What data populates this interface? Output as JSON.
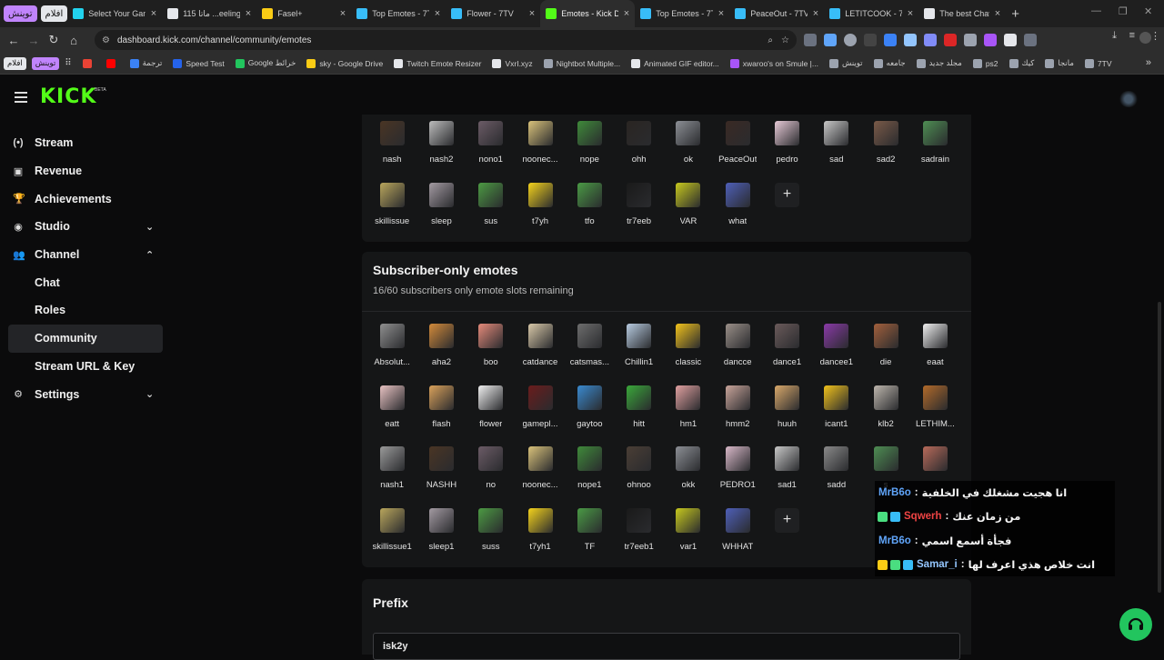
{
  "browser": {
    "tab_groups": [
      {
        "label": "توينش",
        "color": "#c084fc"
      },
      {
        "label": "افلام",
        "color": "#e5e7eb"
      }
    ],
    "tabs": [
      {
        "title": "Select Your Gam",
        "fav_color": "#22d3ee",
        "active": false
      },
      {
        "title": "ماتا 115 ...eeling",
        "fav_color": "#e5e7eb",
        "active": false
      },
      {
        "title": "Fasel+",
        "fav_color": "#facc15",
        "active": false
      },
      {
        "title": "Top Emotes - 7T",
        "fav_color": "#38bdf8",
        "active": false
      },
      {
        "title": "Flower - 7TV",
        "fav_color": "#38bdf8",
        "active": false
      },
      {
        "title": "Emotes - Kick D",
        "fav_color": "#53fc18",
        "active": true
      },
      {
        "title": "Top Emotes - 7T",
        "fav_color": "#38bdf8",
        "active": false
      },
      {
        "title": "PeaceOut - 7TV",
        "fav_color": "#38bdf8",
        "active": false
      },
      {
        "title": "LETITCOOK - 7T",
        "fav_color": "#38bdf8",
        "active": false
      },
      {
        "title": "The best ChatB",
        "fav_color": "#e5e7eb",
        "active": false
      }
    ],
    "new_tab": "+",
    "window_controls": [
      "—",
      "❐",
      "✕"
    ],
    "url": "dashboard.kick.com/channel/community/emotes",
    "bookmarks_chips": [
      {
        "label": "افلام",
        "color": "#e5e7eb"
      },
      {
        "label": "توينش",
        "color": "#c084fc"
      }
    ],
    "bookmarks": [
      {
        "label": "ترجمة",
        "color": "#3b82f6"
      },
      {
        "label": "Speed Test",
        "color": "#2563eb"
      },
      {
        "label": "Google خرائط",
        "color": "#22c55e"
      },
      {
        "label": "sky - Google Drive",
        "color": "#facc15"
      },
      {
        "label": "Twitch Emote Resizer",
        "color": "#e5e7eb"
      },
      {
        "label": "VxrI.xyz",
        "color": "#e5e7eb"
      },
      {
        "label": "Nightbot Multiple...",
        "color": "#9ca3af"
      },
      {
        "label": "Animated GIF editor...",
        "color": "#e5e7eb"
      },
      {
        "label": "xwaroo's on Smule |...",
        "color": "#a855f7"
      },
      {
        "label": "توينش",
        "color": "#9ca3af"
      },
      {
        "label": "جامعه",
        "color": "#9ca3af"
      },
      {
        "label": "مجلد جديد",
        "color": "#9ca3af"
      },
      {
        "label": "ps2",
        "color": "#9ca3af"
      },
      {
        "label": "كيك",
        "color": "#9ca3af"
      },
      {
        "label": "مانجا",
        "color": "#9ca3af"
      },
      {
        "label": "7TV",
        "color": "#9ca3af"
      }
    ]
  },
  "app": {
    "logo": "KICK",
    "beta": "BETA",
    "accent": "#53fc18",
    "sidebar": [
      {
        "label": "Stream",
        "icon": "(•)",
        "chev": ""
      },
      {
        "label": "Revenue",
        "icon": "▣",
        "chev": ""
      },
      {
        "label": "Achievements",
        "icon": "🏆",
        "chev": ""
      },
      {
        "label": "Studio",
        "icon": "◉",
        "chev": "⌄"
      },
      {
        "label": "Channel",
        "icon": "👥",
        "chev": "⌃"
      }
    ],
    "channel_sub": [
      "Chat",
      "Roles",
      "Community",
      "Stream URL & Key"
    ],
    "settings": {
      "label": "Settings",
      "icon": "⚙",
      "chev": "⌄"
    }
  },
  "emotes_top": [
    {
      "name": "nash",
      "color": "#4a3524"
    },
    {
      "name": "nash2",
      "color": "#bcbcbc"
    },
    {
      "name": "nono1",
      "color": "#6b5b66"
    },
    {
      "name": "noonec...",
      "color": "#d9c27a"
    },
    {
      "name": "nope",
      "color": "#3f8a3a"
    },
    {
      "name": "ohh",
      "color": "#2a2522"
    },
    {
      "name": "ok",
      "color": "#8c8f95"
    },
    {
      "name": "PeaceOut",
      "color": "#3a2a24"
    },
    {
      "name": "pedro",
      "color": "#e6c9d6"
    },
    {
      "name": "sad",
      "color": "#c7c7c7"
    },
    {
      "name": "sad2",
      "color": "#7a5a48"
    },
    {
      "name": "sadrain",
      "color": "#4e8e53"
    },
    {
      "name": "skillissue",
      "color": "#b9a65c"
    },
    {
      "name": "sleep",
      "color": "#a39aa2"
    },
    {
      "name": "sus",
      "color": "#4c9a43"
    },
    {
      "name": "t7yh",
      "color": "#f4d21c"
    },
    {
      "name": "tfo",
      "color": "#4a9a45"
    },
    {
      "name": "tr7eeb",
      "color": "#1a1a1a"
    },
    {
      "name": "VAR",
      "color": "#c6c81e"
    },
    {
      "name": "what",
      "color": "#4e5fb8"
    }
  ],
  "subscriber_section": {
    "title": "Subscriber-only emotes",
    "subtitle": "16/60 subscribers only emote slots remaining"
  },
  "emotes_sub": [
    {
      "name": "Absolut...",
      "color": "#8f8f8f"
    },
    {
      "name": "aha2",
      "color": "#d28a3a"
    },
    {
      "name": "boo",
      "color": "#e58a7a"
    },
    {
      "name": "catdance",
      "color": "#d8c8a8"
    },
    {
      "name": "catsmas...",
      "color": "#6d6d6d"
    },
    {
      "name": "Chillin1",
      "color": "#b7cbe0"
    },
    {
      "name": "classic",
      "color": "#f1c21b"
    },
    {
      "name": "dancce",
      "color": "#9a8f88"
    },
    {
      "name": "dance1",
      "color": "#6a5a5a"
    },
    {
      "name": "dancee1",
      "color": "#8a3aa8"
    },
    {
      "name": "die",
      "color": "#a2603c"
    },
    {
      "name": "eaat",
      "color": "#efefef"
    },
    {
      "name": "eatt",
      "color": "#e8c2c2"
    },
    {
      "name": "flash",
      "color": "#d9a15a"
    },
    {
      "name": "flower",
      "color": "#efefef"
    },
    {
      "name": "gamepl...",
      "color": "#6a1c1c"
    },
    {
      "name": "gaytoo",
      "color": "#3a8ad0"
    },
    {
      "name": "hitt",
      "color": "#3aa83a"
    },
    {
      "name": "hm1",
      "color": "#e0a0a0"
    },
    {
      "name": "hmm2",
      "color": "#c8a49a"
    },
    {
      "name": "huuh",
      "color": "#d8a86a"
    },
    {
      "name": "icant1",
      "color": "#f1c21b"
    },
    {
      "name": "klb2",
      "color": "#bdb6ad"
    },
    {
      "name": "LETHIM...",
      "color": "#b26a2a"
    },
    {
      "name": "nash1",
      "color": "#9a9a9a"
    },
    {
      "name": "NASHH",
      "color": "#4a3524"
    },
    {
      "name": "no",
      "color": "#6b5b66"
    },
    {
      "name": "noonec...",
      "color": "#d9c27a"
    },
    {
      "name": "nope1",
      "color": "#3f8a3a"
    },
    {
      "name": "ohnoo",
      "color": "#4a3e35"
    },
    {
      "name": "okk",
      "color": "#8c8f95"
    },
    {
      "name": "PEDRO1",
      "color": "#d8b8c8"
    },
    {
      "name": "sad1",
      "color": "#c7c7c7"
    },
    {
      "name": "sadd",
      "color": "#8a8a8a"
    },
    {
      "name": "s",
      "color": "#4e8e53"
    },
    {
      "name": "",
      "color": "#b86a5a"
    },
    {
      "name": "skillissue1",
      "color": "#b9a65c"
    },
    {
      "name": "sleep1",
      "color": "#a39aa2"
    },
    {
      "name": "suss",
      "color": "#4c9a43"
    },
    {
      "name": "t7yh1",
      "color": "#f4d21c"
    },
    {
      "name": "TF",
      "color": "#4a9a45"
    },
    {
      "name": "tr7eeb1",
      "color": "#1a1a1a"
    },
    {
      "name": "var1",
      "color": "#c6c81e"
    },
    {
      "name": "WHHAT",
      "color": "#4e5fb8"
    }
  ],
  "add_label": "+",
  "prefix_section": {
    "title": "Prefix",
    "value": "isk2y"
  },
  "chat_overlay": [
    {
      "user": "MrB6o",
      "user_color": "#60a5fa",
      "sep": ":",
      "message": "انا هجيت مشغلك في الخلفية",
      "badges": []
    },
    {
      "user": "Sqwerh",
      "user_color": "#ef4444",
      "sep": ":",
      "message": "من زمان عنك",
      "badges": [
        "#38bdf8",
        "#4ade80"
      ]
    },
    {
      "user": "MrB6o",
      "user_color": "#60a5fa",
      "sep": ":",
      "message": "فجأة أسمع اسمي",
      "badges": []
    },
    {
      "user": "Samar_i",
      "user_color": "#93c5fd",
      "sep": ":",
      "message": "انت خلاص هذي اعرف لها",
      "badges": [
        "#38bdf8",
        "#4ade80",
        "#facc15"
      ]
    }
  ]
}
